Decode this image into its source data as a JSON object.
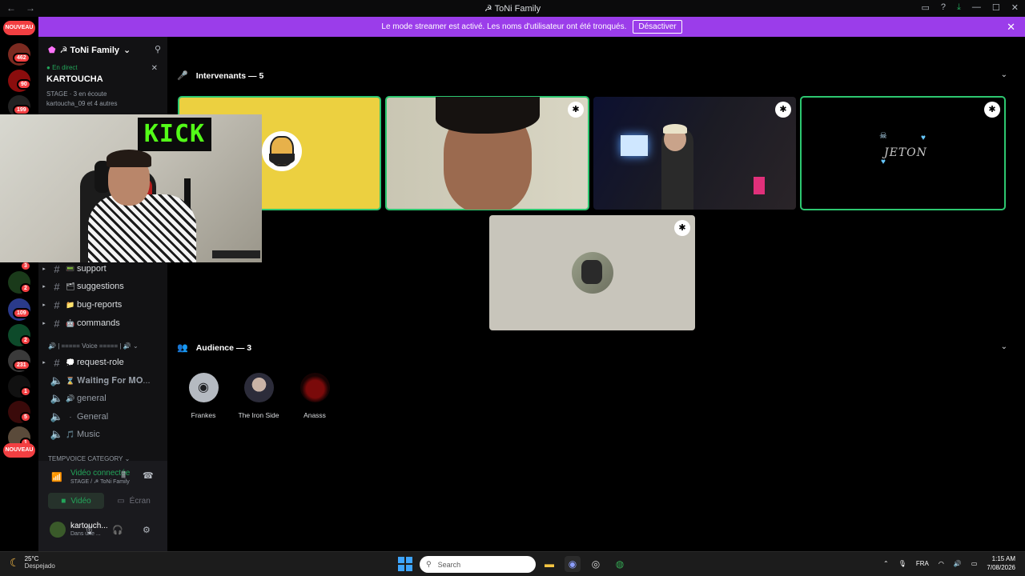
{
  "window": {
    "title": "☭ ToNi Family"
  },
  "banner": {
    "text": "Le mode streamer est activé. Les noms d'utilisateur ont été tronqués.",
    "button": "Désactiver"
  },
  "rail": {
    "new_label": "NOUVEAU",
    "badges": [
      "462",
      "90",
      "199",
      "3",
      "2",
      "109",
      "2",
      "231",
      "1",
      "5",
      "1"
    ]
  },
  "server": {
    "name": "☭ ToNi Family"
  },
  "live": {
    "status": "En direct",
    "name": "KARTOUCHA",
    "meta": "STAGE · 3 en écoute",
    "others": "kartoucha_09 et 4 autres"
  },
  "channels": [
    {
      "emoji": "📟",
      "name": "support",
      "type": "text"
    },
    {
      "emoji": "🗂",
      "name": "suggestions",
      "type": "text"
    },
    {
      "emoji": "📁",
      "name": "bug-reports",
      "type": "text"
    },
    {
      "emoji": "🤖",
      "name": "commands",
      "type": "text"
    }
  ],
  "voice_category": "| ===== Voice ===== |",
  "voice_channels": [
    {
      "emoji": "💭",
      "name": "request-role",
      "type": "text"
    },
    {
      "emoji": "⌛",
      "name": "𝐖𝐚𝐢𝐭𝐢𝐧𝐠 𝐅𝐨𝐫 𝐌𝐎...",
      "type": "voice"
    },
    {
      "emoji": "🔊",
      "name": "general",
      "type": "voice"
    },
    {
      "emoji": "",
      "name": "General",
      "type": "voice"
    },
    {
      "emoji": "🎵",
      "name": "Music",
      "type": "voice"
    }
  ],
  "temp_category": "TEMPVOICE CATEGORY",
  "voice_panel": {
    "status": "Vidéo connectée",
    "location": "STAGE / ☭ ToNi Family",
    "video_label": "Vidéo",
    "screen_label": "Écran"
  },
  "user": {
    "name": "kartouch...",
    "status": "Dans une ..."
  },
  "stage": {
    "speakers_header": "Intervenants — 5",
    "audience_header": "Audience — 3",
    "stream_tag": "KICK",
    "tile_text": "JETON",
    "audience": [
      {
        "name": "Frankes"
      },
      {
        "name": "The Iron Side"
      },
      {
        "name": "Anasss"
      }
    ]
  },
  "taskbar": {
    "temp": "25°C",
    "weather": "Despejado",
    "search_placeholder": "Search",
    "lang": "FRA",
    "time": "1:15 AM",
    "date": "7/08/2026"
  },
  "colors": {
    "accent": "#9b3dea",
    "speaking": "#2dc770",
    "badge": "#f23f42",
    "connected": "#23a55a"
  }
}
